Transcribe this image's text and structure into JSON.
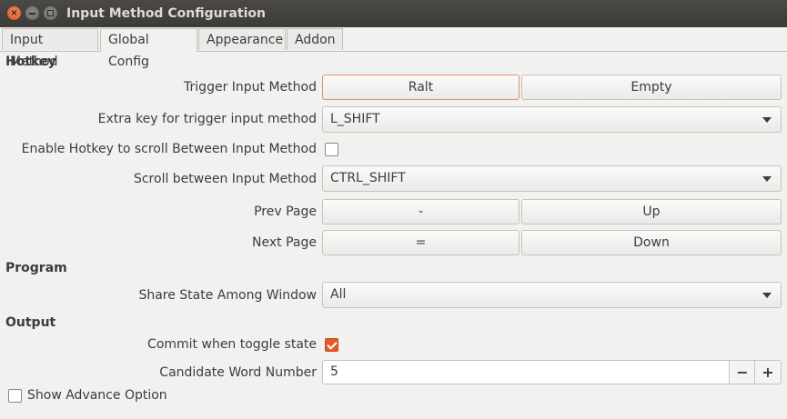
{
  "window": {
    "title": "Input Method Configuration"
  },
  "tabs": [
    "Input Method",
    "Global Config",
    "Appearance",
    "Addon"
  ],
  "sections": {
    "hotkey": "Hotkey",
    "program": "Program",
    "output": "Output"
  },
  "trigger": {
    "label": "Trigger Input Method",
    "key1": "Ralt",
    "key2": "Empty"
  },
  "extra_key": {
    "label": "Extra key for trigger input method",
    "value": "L_SHIFT"
  },
  "enable_scroll": {
    "label": "Enable Hotkey to scroll Between Input Method",
    "checked": false
  },
  "scroll": {
    "label": "Scroll between Input Method",
    "value": "CTRL_SHIFT"
  },
  "prev_page": {
    "label": "Prev Page",
    "key1": "-",
    "key2": "Up"
  },
  "next_page": {
    "label": "Next Page",
    "key1": "=",
    "key2": "Down"
  },
  "share_state": {
    "label": "Share State Among Window",
    "value": "All"
  },
  "commit_toggle": {
    "label": "Commit when toggle state",
    "checked": true
  },
  "candidate": {
    "label": "Candidate Word Number",
    "value": "5",
    "minus": "−",
    "plus": "+"
  },
  "advance": {
    "label": "Show Advance Option",
    "checked": false
  }
}
